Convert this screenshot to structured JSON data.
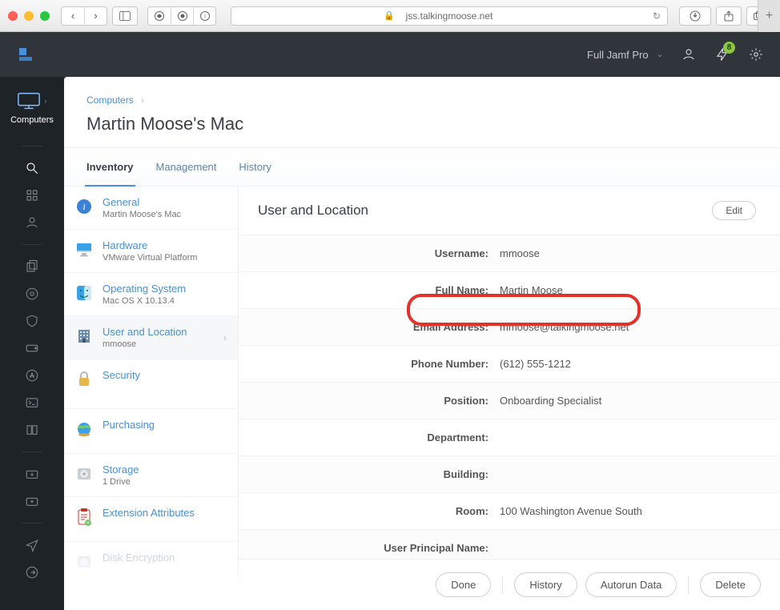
{
  "browser": {
    "url": "jss.talkingmoose.net"
  },
  "header": {
    "instance": "Full Jamf Pro",
    "notif_count": "8"
  },
  "rail": {
    "computers_label": "Computers"
  },
  "crumbs": {
    "root": "Computers"
  },
  "page_title": "Martin Moose's Mac",
  "tabs": {
    "inventory": "Inventory",
    "management": "Management",
    "history": "History"
  },
  "inv": {
    "general": {
      "label": "General",
      "sub": "Martin Moose's Mac"
    },
    "hardware": {
      "label": "Hardware",
      "sub": "VMware Virtual Platform"
    },
    "os": {
      "label": "Operating System",
      "sub": "Mac OS X 10.13.4"
    },
    "userloc": {
      "label": "User and Location",
      "sub": "mmoose"
    },
    "security": {
      "label": "Security"
    },
    "purchasing": {
      "label": "Purchasing"
    },
    "storage": {
      "label": "Storage",
      "sub": "1 Drive"
    },
    "ext": {
      "label": "Extension Attributes"
    },
    "disk": {
      "label": "Disk Encryption"
    }
  },
  "detail": {
    "title": "User and Location",
    "edit": "Edit",
    "rows": {
      "username": {
        "k": "Username:",
        "v": "mmoose"
      },
      "fullname": {
        "k": "Full Name:",
        "v": "Martin Moose"
      },
      "email": {
        "k": "Email Address:",
        "v": "mmoose@talkingmoose.net"
      },
      "phone": {
        "k": "Phone Number:",
        "v": "(612) 555-1212"
      },
      "position": {
        "k": "Position:",
        "v": "Onboarding Specialist"
      },
      "department": {
        "k": "Department:",
        "v": ""
      },
      "building": {
        "k": "Building:",
        "v": ""
      },
      "room": {
        "k": "Room:",
        "v": "100 Washington Avenue South"
      },
      "upn": {
        "k": "User Principal Name:",
        "v": ""
      }
    }
  },
  "footer": {
    "done": "Done",
    "history": "History",
    "autorun": "Autorun Data",
    "delete": "Delete"
  }
}
